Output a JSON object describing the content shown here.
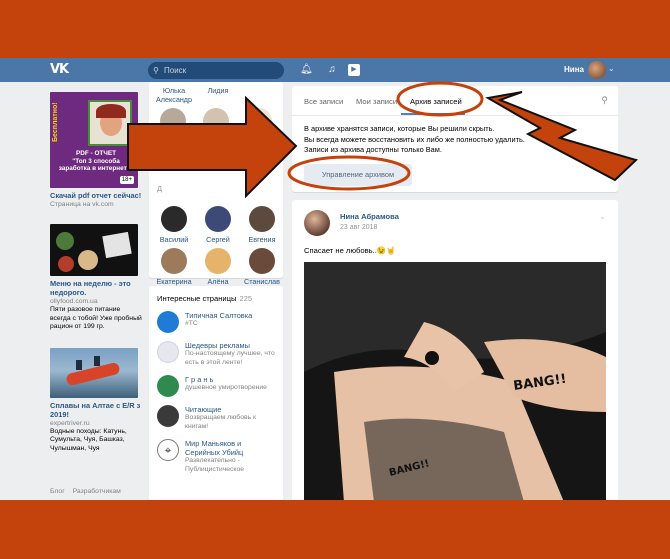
{
  "header": {
    "logo": "VK",
    "search_placeholder": "Поиск",
    "icons": [
      "bell-icon",
      "music-icon",
      "video-play-icon"
    ],
    "user_name": "Нина"
  },
  "ads": [
    {
      "image_lines": [
        "Бесплатно!",
        "PDF - ОТЧЕТ",
        "\"Топ 3 способа",
        "заработка в интернете\""
      ],
      "badge": "18+",
      "title": "Скачай pdf отчет сейчас!",
      "sub": "Страница на vk.com"
    },
    {
      "title": "Меню на неделю - это недорого.",
      "sub": "ollyfood.com.ua",
      "text": "Пяти разовое питание всегда с тобой! Уже пробный рацион от 199 гр."
    },
    {
      "title": "Сплавы на Алтае с E/R з 2019!",
      "sub": "expertriver.ru",
      "text": "Водные походы: Катунь, Сумульта, Чуя, Башказ, Чулышман, Чуя"
    }
  ],
  "footer_links": [
    "Блог",
    "Разработчикам"
  ],
  "friends": {
    "top_row": [
      "Юлька",
      "Лидия",
      "Александр"
    ],
    "section_letter": "Д",
    "rows": [
      "Василий",
      "Сергей",
      "Евгения",
      "Екатерина",
      "Алёна",
      "Станислав"
    ]
  },
  "pages": {
    "title": "Интересные страницы",
    "count": "225",
    "items": [
      {
        "name": "Типичная Салтовка",
        "desc": "#ТС"
      },
      {
        "name": "Шедевры рекламы",
        "desc": "По-настоящему лучшее, что есть в этой ленте!"
      },
      {
        "name": "Г р а н ь",
        "desc": "душевное умиротворение"
      },
      {
        "name": "Читающие",
        "desc": "Возвращаем любовь к книгам!"
      },
      {
        "name": "Мир Маньяков и Серийных Убийц",
        "desc": "Развлекательно - Публицистическое"
      }
    ]
  },
  "wall": {
    "tabs": [
      "Все записи",
      "Мои записи",
      "Архив записей"
    ],
    "active_tab": "Архив записей",
    "info": [
      "В архиве хранятся записи, которые Вы решили скрыть.",
      "Вы всегда можете восстановить их либо же полностью удалить.",
      "Записи из архива доступны только Вам."
    ],
    "manage_button": "Управление архивом"
  },
  "post": {
    "author": "Нина Абрамова",
    "date": "23 авг 2018",
    "text": "Спасает не любовь..😉🤘",
    "photo_caption_1": "BANG!!",
    "photo_caption_2": "BANG!!"
  },
  "colors": {
    "frame": "#c4420c",
    "header": "#4a76a8",
    "link": "#2a5885",
    "annotation": "#c4420c"
  }
}
